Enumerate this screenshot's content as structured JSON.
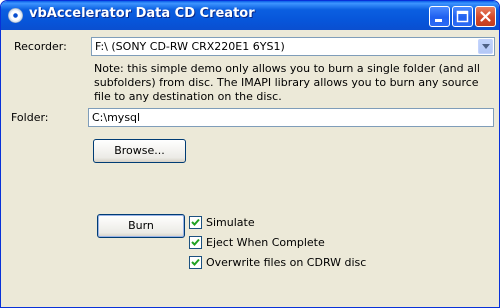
{
  "window": {
    "title": "vbAccelerator Data CD Creator",
    "icon": "cd-disc-icon",
    "title_bar_color": "#0a5fe8",
    "close_button_color": "#d4482a"
  },
  "recorder": {
    "label": "Recorder:",
    "selected": "F:\\ (SONY CD-RW CRX220E1 6YS1)"
  },
  "note": "Note: this simple demo only allows you to burn a single folder (and all subfolders) from disc.  The IMAPI library allows you to burn any source file to any destination on the disc.",
  "folder": {
    "label": "Folder:",
    "value": "C:\\mysql"
  },
  "buttons": {
    "browse": "Browse...",
    "burn": "Burn"
  },
  "options": [
    {
      "label": "Simulate",
      "checked": true
    },
    {
      "label": "Eject When Complete",
      "checked": true
    },
    {
      "label": "Overwrite files on CDRW disc",
      "checked": true
    }
  ]
}
